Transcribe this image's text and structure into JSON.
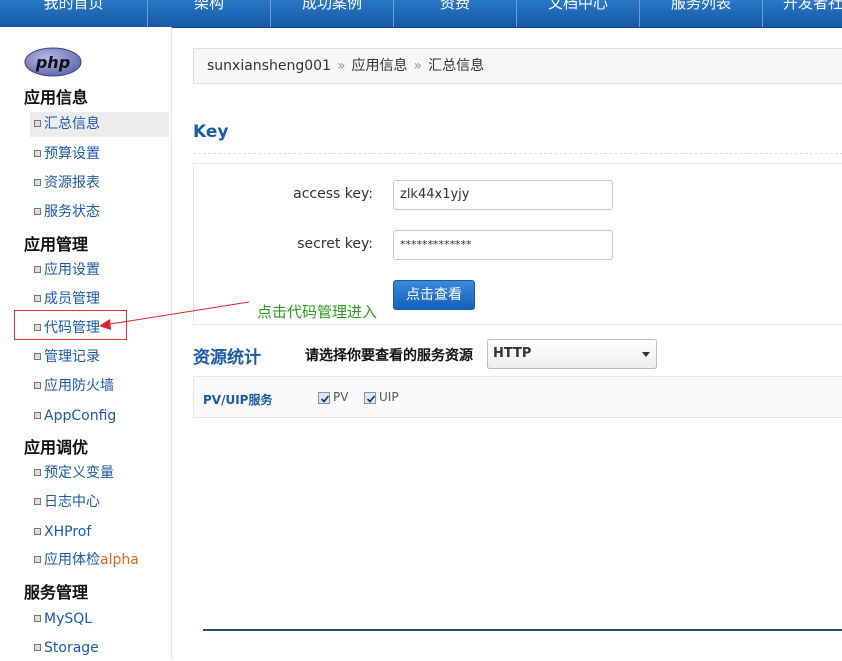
{
  "topnav": {
    "items": [
      {
        "label": "我的首页"
      },
      {
        "label": "架构"
      },
      {
        "label": "成功案例"
      },
      {
        "label": "资费"
      },
      {
        "label": "文档中心"
      },
      {
        "label": "服务列表"
      },
      {
        "label": "开发者社"
      }
    ]
  },
  "sidebar": {
    "logo_text": "php",
    "sections": [
      {
        "title": "应用信息",
        "items": [
          "汇总信息",
          "预算设置",
          "资源报表",
          "服务状态"
        ]
      },
      {
        "title": "应用管理",
        "items": [
          "应用设置",
          "成员管理",
          "代码管理",
          "管理记录",
          "应用防火墙",
          "AppConfig"
        ]
      },
      {
        "title": "应用调优",
        "items": [
          "预定义变量",
          "日志中心",
          "XHProf",
          "应用体检"
        ]
      },
      {
        "title": "服务管理",
        "items": [
          "MySQL",
          "Storage"
        ]
      }
    ],
    "alpha_badge": "alpha",
    "active_item": "汇总信息",
    "highlighted_item": "代码管理"
  },
  "breadcrumb": {
    "parts": [
      "sunxiansheng001",
      "应用信息",
      "汇总信息"
    ],
    "separator": "»"
  },
  "key_section": {
    "title": "Key",
    "access_key_label": "access key:",
    "access_key_value": "zlk44x1yjy",
    "secret_key_label": "secret key:",
    "secret_key_value": "*************",
    "view_button": "点击查看"
  },
  "annotation": {
    "text": "点击代码管理进入",
    "color": "#2f9a21",
    "arrow_color": "#d9262a"
  },
  "resource_section": {
    "title": "资源统计",
    "select_label": "请选择你要查看的服务资源",
    "selected_service": "HTTP",
    "pv_title": "PV/UIP服务",
    "pv_label": "PV",
    "pv_checked": true,
    "uip_label": "UIP",
    "uip_checked": true
  },
  "colors": {
    "nav_bg": "#1a63b3",
    "link": "#1a5aa8",
    "highlight_border": "#e2332f"
  }
}
